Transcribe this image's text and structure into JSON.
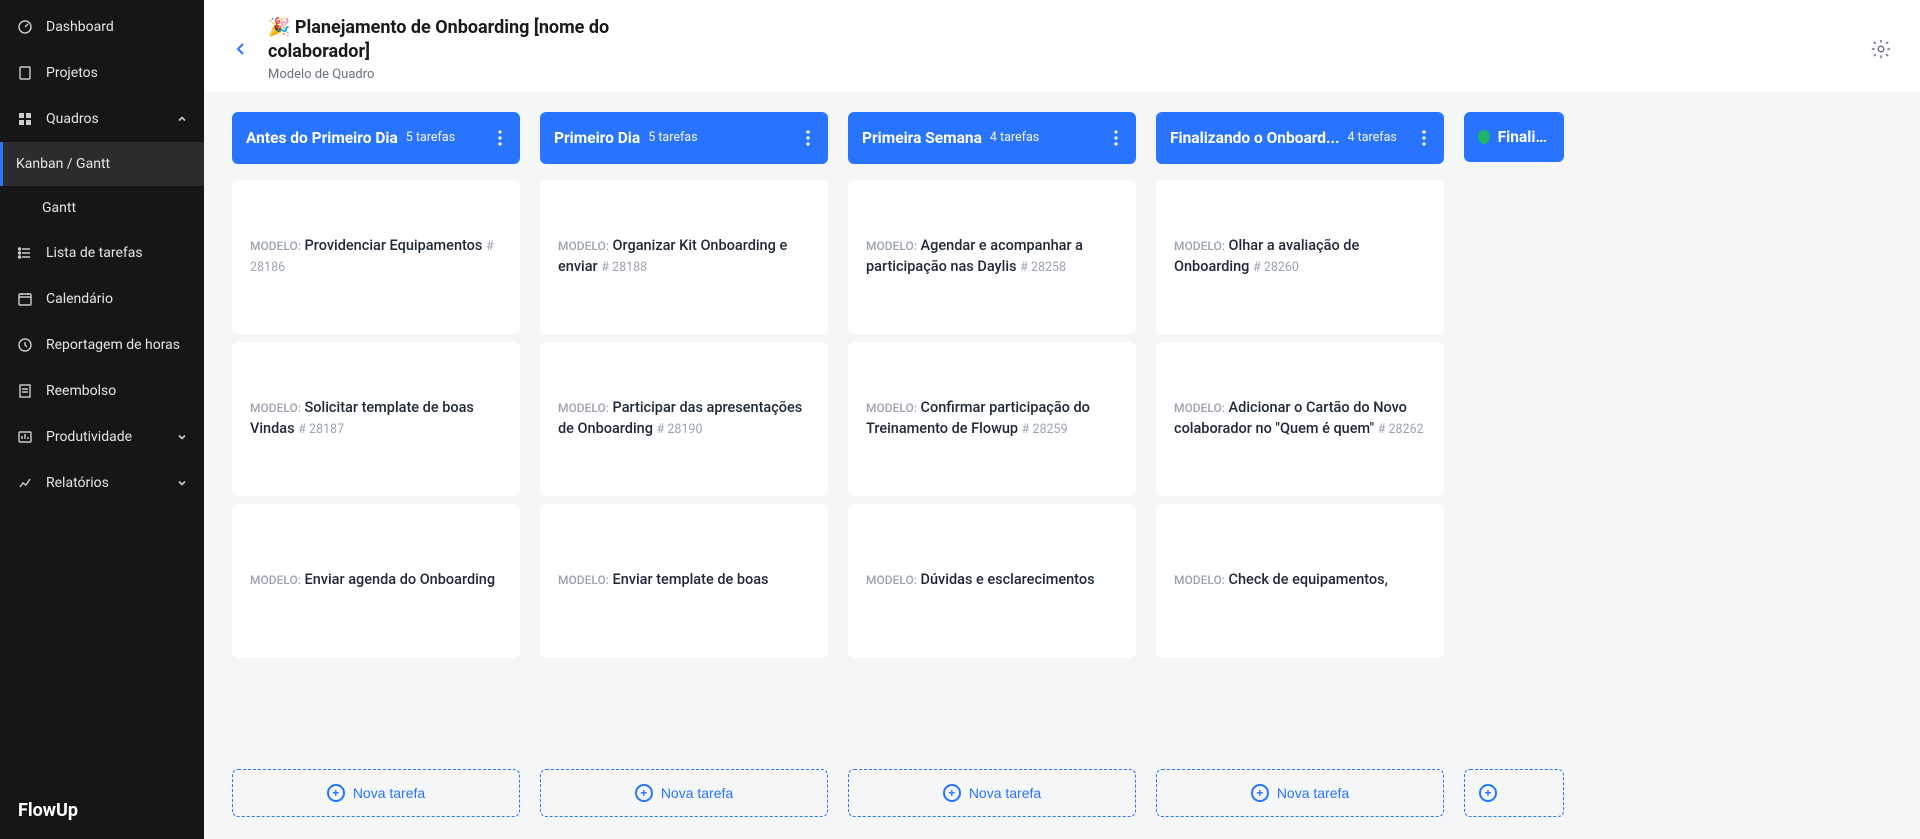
{
  "brand": "FlowUp",
  "sidebar": {
    "items": [
      {
        "label": "Dashboard",
        "icon": "dashboard-icon"
      },
      {
        "label": "Projetos",
        "icon": "projects-icon"
      },
      {
        "label": "Quadros",
        "icon": "boards-icon",
        "expandable": true,
        "expanded": true
      },
      {
        "label": "Kanban / Gantt",
        "sub": true,
        "active": true
      },
      {
        "label": "Gantt",
        "sub": true
      },
      {
        "label": "Lista de tarefas",
        "icon": "list-icon"
      },
      {
        "label": "Calendário",
        "icon": "calendar-icon"
      },
      {
        "label": "Reportagem de horas",
        "icon": "clock-icon"
      },
      {
        "label": "Reembolso",
        "icon": "receipt-icon"
      },
      {
        "label": "Produtividade",
        "icon": "productivity-icon",
        "expandable": true
      },
      {
        "label": "Relatórios",
        "icon": "reports-icon",
        "expandable": true
      }
    ]
  },
  "header": {
    "emoji": "🎉",
    "title": "Planejamento de Onboarding [nome do colaborador]",
    "subtitle": "Modelo de Quadro"
  },
  "board": {
    "card_label": "MODELO:",
    "add_task_label": "Nova tarefa",
    "columns": [
      {
        "title": "Antes do Primeiro Dia",
        "count_label": "5 tarefas",
        "cards": [
          {
            "title": "Providenciar Equipamentos",
            "id": "# 28186"
          },
          {
            "title": "Solicitar template de boas Vindas",
            "id": "# 28187"
          },
          {
            "title": "Enviar agenda do Onboarding",
            "id": ""
          }
        ]
      },
      {
        "title": "Primeiro Dia",
        "count_label": "5 tarefas",
        "cards": [
          {
            "title": "Organizar Kit Onboarding e enviar",
            "id": "# 28188"
          },
          {
            "title": "Participar das apresentações de Onboarding",
            "id": "# 28190"
          },
          {
            "title": "Enviar template de boas",
            "id": ""
          }
        ]
      },
      {
        "title": "Primeira Semana",
        "count_label": "4 tarefas",
        "cards": [
          {
            "title": "Agendar e acompanhar a participação nas Daylis",
            "id": "# 28258"
          },
          {
            "title": "Confirmar participação do Treinamento de Flowup",
            "id": "# 28259"
          },
          {
            "title": "Dúvidas e esclarecimentos",
            "id": ""
          }
        ]
      },
      {
        "title": "Finalizando o Onboard...",
        "count_label": "4 tarefas",
        "cards": [
          {
            "title": "Olhar a avaliação de Onboarding",
            "id": "# 28260"
          },
          {
            "title": "Adicionar o Cartão do Novo colaborador no \"Quem é quem\"",
            "id": "# 28262"
          },
          {
            "title": "Check de equipamentos,",
            "id": ""
          }
        ]
      },
      {
        "title": "Finalizad",
        "green": true,
        "partial": true
      }
    ]
  }
}
